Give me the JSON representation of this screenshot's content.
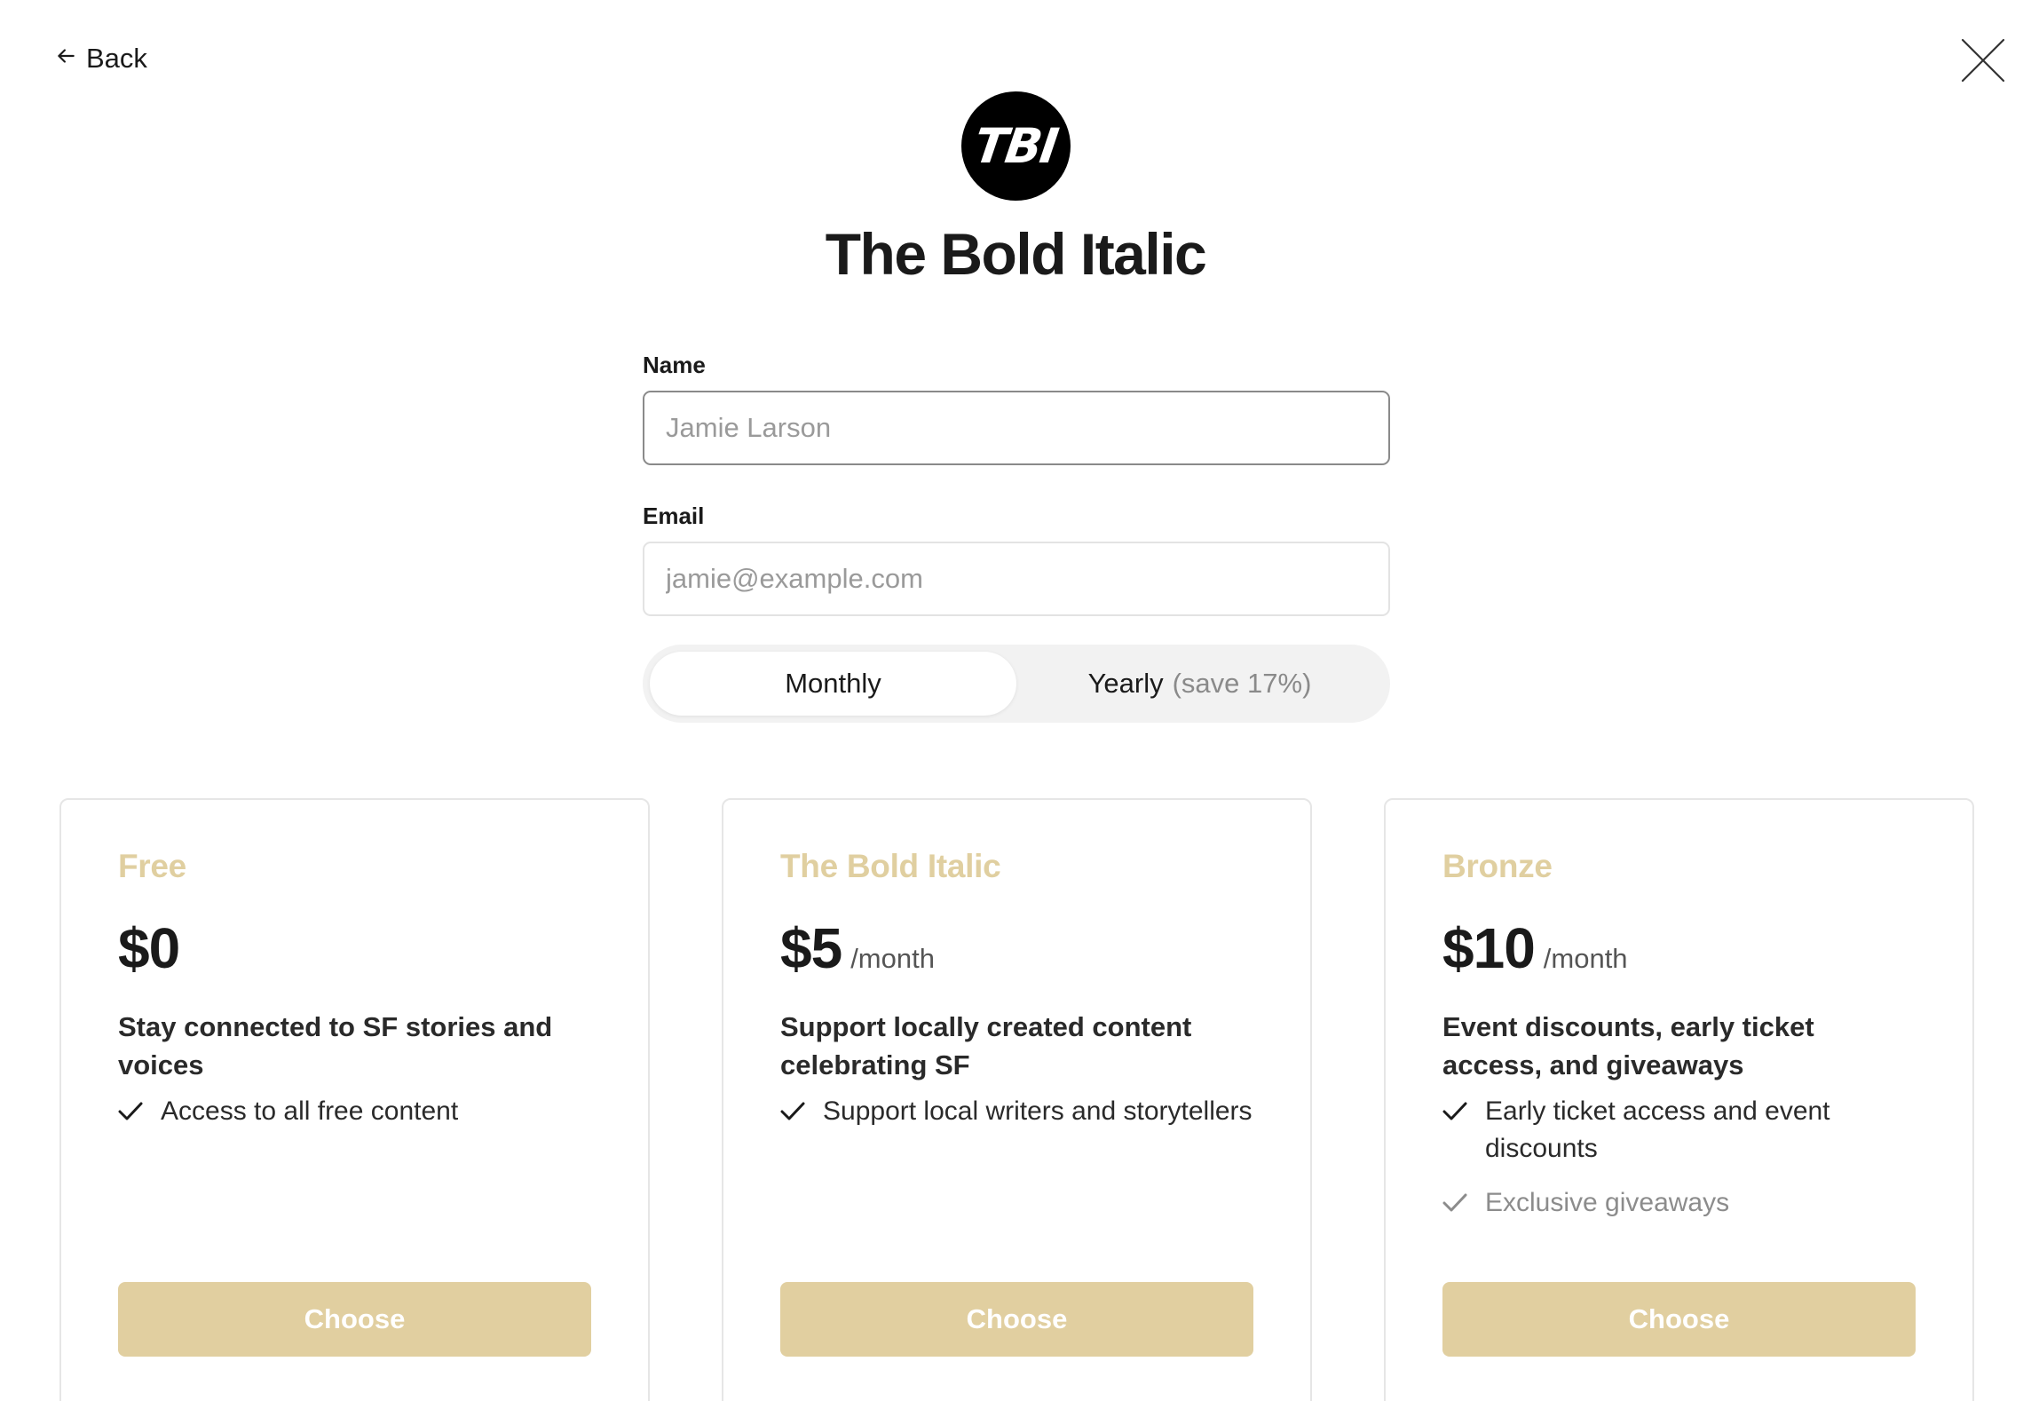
{
  "nav": {
    "back_label": "Back",
    "back_icon": "arrow-left-icon",
    "close_icon": "close-icon"
  },
  "publication": {
    "logo_text": "TBI",
    "title": "The Bold Italic"
  },
  "form": {
    "name_label": "Name",
    "name_placeholder": "Jamie Larson",
    "name_value": "",
    "email_label": "Email",
    "email_placeholder": "jamie@example.com",
    "email_value": ""
  },
  "billing_toggle": {
    "monthly_label": "Monthly",
    "yearly_label": "Yearly",
    "yearly_note": "(save 17%)",
    "selected": "Monthly"
  },
  "tiers": [
    {
      "name": "Free",
      "price": "$0",
      "period": "",
      "description": "Stay connected to SF stories and voices",
      "benefits": [
        {
          "text": "Access to all free content",
          "muted": false
        }
      ],
      "button_label": "Choose"
    },
    {
      "name": "The Bold Italic",
      "price": "$5",
      "period": "/month",
      "description": "Support locally created content celebrating SF",
      "benefits": [
        {
          "text": "Support local writers and storytellers",
          "muted": false
        }
      ],
      "button_label": "Choose"
    },
    {
      "name": "Bronze",
      "price": "$10",
      "period": "/month",
      "description": "Event discounts, early ticket access, and giveaways",
      "benefits": [
        {
          "text": "Early ticket access and event discounts",
          "muted": false
        },
        {
          "text": "Exclusive giveaways",
          "muted": true
        }
      ],
      "button_label": "Choose"
    }
  ],
  "colors": {
    "accent": "#e1cfa0",
    "tier_name": "#e0cfa0",
    "text": "#1a1a1a",
    "muted": "#8c8c8c",
    "border": "#e6e6e6"
  }
}
